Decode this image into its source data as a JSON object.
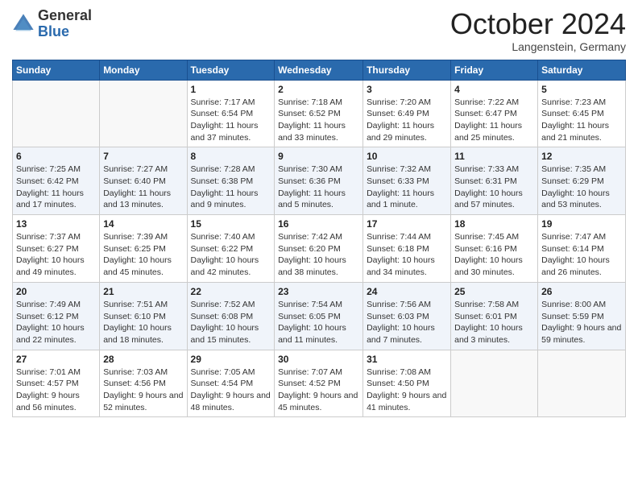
{
  "header": {
    "logo_general": "General",
    "logo_blue": "Blue",
    "month_title": "October 2024",
    "subtitle": "Langenstein, Germany"
  },
  "days_of_week": [
    "Sunday",
    "Monday",
    "Tuesday",
    "Wednesday",
    "Thursday",
    "Friday",
    "Saturday"
  ],
  "weeks": [
    [
      {
        "day": "",
        "info": ""
      },
      {
        "day": "",
        "info": ""
      },
      {
        "day": "1",
        "info": "Sunrise: 7:17 AM\nSunset: 6:54 PM\nDaylight: 11 hours and 37 minutes."
      },
      {
        "day": "2",
        "info": "Sunrise: 7:18 AM\nSunset: 6:52 PM\nDaylight: 11 hours and 33 minutes."
      },
      {
        "day": "3",
        "info": "Sunrise: 7:20 AM\nSunset: 6:49 PM\nDaylight: 11 hours and 29 minutes."
      },
      {
        "day": "4",
        "info": "Sunrise: 7:22 AM\nSunset: 6:47 PM\nDaylight: 11 hours and 25 minutes."
      },
      {
        "day": "5",
        "info": "Sunrise: 7:23 AM\nSunset: 6:45 PM\nDaylight: 11 hours and 21 minutes."
      }
    ],
    [
      {
        "day": "6",
        "info": "Sunrise: 7:25 AM\nSunset: 6:42 PM\nDaylight: 11 hours and 17 minutes."
      },
      {
        "day": "7",
        "info": "Sunrise: 7:27 AM\nSunset: 6:40 PM\nDaylight: 11 hours and 13 minutes."
      },
      {
        "day": "8",
        "info": "Sunrise: 7:28 AM\nSunset: 6:38 PM\nDaylight: 11 hours and 9 minutes."
      },
      {
        "day": "9",
        "info": "Sunrise: 7:30 AM\nSunset: 6:36 PM\nDaylight: 11 hours and 5 minutes."
      },
      {
        "day": "10",
        "info": "Sunrise: 7:32 AM\nSunset: 6:33 PM\nDaylight: 11 hours and 1 minute."
      },
      {
        "day": "11",
        "info": "Sunrise: 7:33 AM\nSunset: 6:31 PM\nDaylight: 10 hours and 57 minutes."
      },
      {
        "day": "12",
        "info": "Sunrise: 7:35 AM\nSunset: 6:29 PM\nDaylight: 10 hours and 53 minutes."
      }
    ],
    [
      {
        "day": "13",
        "info": "Sunrise: 7:37 AM\nSunset: 6:27 PM\nDaylight: 10 hours and 49 minutes."
      },
      {
        "day": "14",
        "info": "Sunrise: 7:39 AM\nSunset: 6:25 PM\nDaylight: 10 hours and 45 minutes."
      },
      {
        "day": "15",
        "info": "Sunrise: 7:40 AM\nSunset: 6:22 PM\nDaylight: 10 hours and 42 minutes."
      },
      {
        "day": "16",
        "info": "Sunrise: 7:42 AM\nSunset: 6:20 PM\nDaylight: 10 hours and 38 minutes."
      },
      {
        "day": "17",
        "info": "Sunrise: 7:44 AM\nSunset: 6:18 PM\nDaylight: 10 hours and 34 minutes."
      },
      {
        "day": "18",
        "info": "Sunrise: 7:45 AM\nSunset: 6:16 PM\nDaylight: 10 hours and 30 minutes."
      },
      {
        "day": "19",
        "info": "Sunrise: 7:47 AM\nSunset: 6:14 PM\nDaylight: 10 hours and 26 minutes."
      }
    ],
    [
      {
        "day": "20",
        "info": "Sunrise: 7:49 AM\nSunset: 6:12 PM\nDaylight: 10 hours and 22 minutes."
      },
      {
        "day": "21",
        "info": "Sunrise: 7:51 AM\nSunset: 6:10 PM\nDaylight: 10 hours and 18 minutes."
      },
      {
        "day": "22",
        "info": "Sunrise: 7:52 AM\nSunset: 6:08 PM\nDaylight: 10 hours and 15 minutes."
      },
      {
        "day": "23",
        "info": "Sunrise: 7:54 AM\nSunset: 6:05 PM\nDaylight: 10 hours and 11 minutes."
      },
      {
        "day": "24",
        "info": "Sunrise: 7:56 AM\nSunset: 6:03 PM\nDaylight: 10 hours and 7 minutes."
      },
      {
        "day": "25",
        "info": "Sunrise: 7:58 AM\nSunset: 6:01 PM\nDaylight: 10 hours and 3 minutes."
      },
      {
        "day": "26",
        "info": "Sunrise: 8:00 AM\nSunset: 5:59 PM\nDaylight: 9 hours and 59 minutes."
      }
    ],
    [
      {
        "day": "27",
        "info": "Sunrise: 7:01 AM\nSunset: 4:57 PM\nDaylight: 9 hours and 56 minutes."
      },
      {
        "day": "28",
        "info": "Sunrise: 7:03 AM\nSunset: 4:56 PM\nDaylight: 9 hours and 52 minutes."
      },
      {
        "day": "29",
        "info": "Sunrise: 7:05 AM\nSunset: 4:54 PM\nDaylight: 9 hours and 48 minutes."
      },
      {
        "day": "30",
        "info": "Sunrise: 7:07 AM\nSunset: 4:52 PM\nDaylight: 9 hours and 45 minutes."
      },
      {
        "day": "31",
        "info": "Sunrise: 7:08 AM\nSunset: 4:50 PM\nDaylight: 9 hours and 41 minutes."
      },
      {
        "day": "",
        "info": ""
      },
      {
        "day": "",
        "info": ""
      }
    ]
  ]
}
